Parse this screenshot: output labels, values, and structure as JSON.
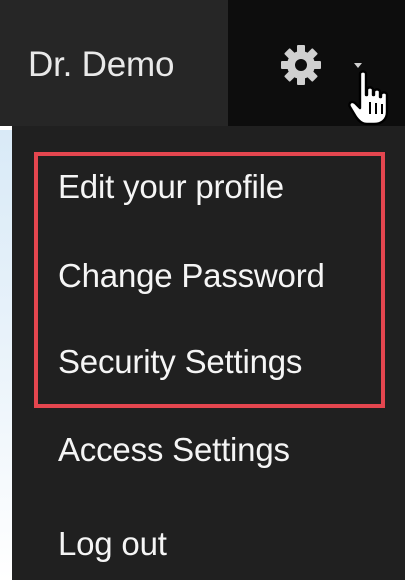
{
  "header": {
    "user_name": "Dr. Demo"
  },
  "menu": {
    "items": [
      {
        "label": "Edit your profile"
      },
      {
        "label": "Change Password"
      },
      {
        "label": "Security Settings"
      },
      {
        "label": "Access Settings"
      },
      {
        "label": "Log out"
      }
    ]
  },
  "colors": {
    "topbar": "#262626",
    "gear_button": "#0d0d0d",
    "menu_background": "#202020",
    "highlight_border": "#e4464f",
    "text": "#f5f5f5"
  },
  "icons": {
    "gear": "gear-icon",
    "caret": "caret-down-icon",
    "cursor": "hand-pointer-icon"
  }
}
